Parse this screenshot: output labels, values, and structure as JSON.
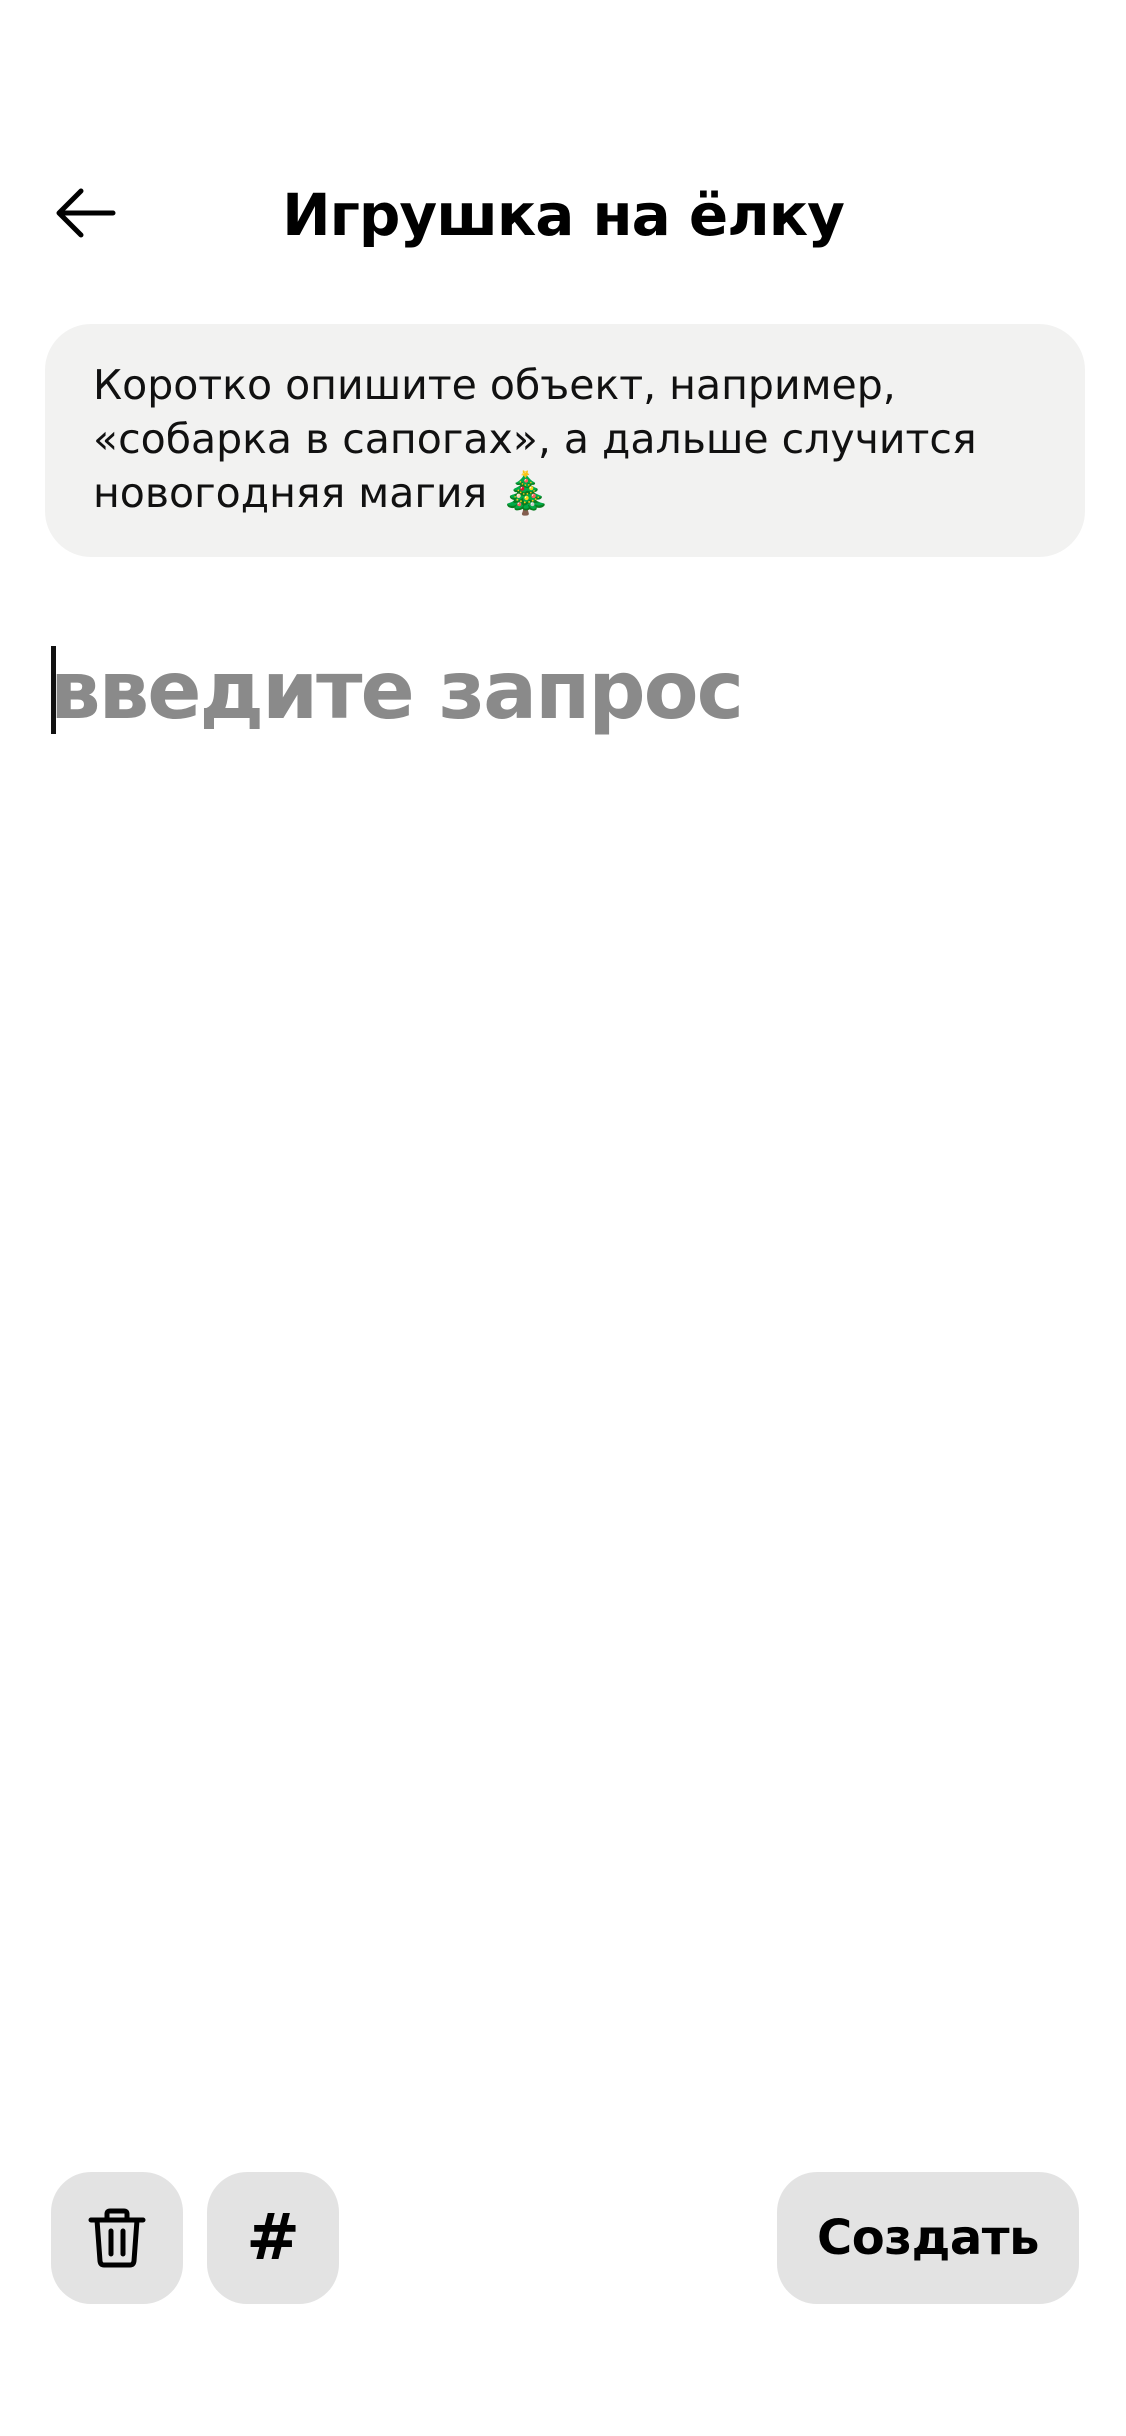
{
  "header": {
    "title": "Игрушка на ёлку",
    "back_icon": "arrow-left-icon"
  },
  "hint": {
    "text": "Коротко опишите объект, например,\n«собарка в сапогах», а дальше случится\nновогодняя магия 🎄"
  },
  "query": {
    "value": "",
    "placeholder": "введите запрос"
  },
  "toolbar": {
    "delete_icon": "trash-icon",
    "hashtag_icon": "hashtag-icon",
    "hashtag_symbol": "#",
    "create_label": "Создать"
  },
  "colors": {
    "background": "#ffffff",
    "hint_background": "#f2f2f1",
    "button_background": "#e3e3e3",
    "placeholder": "#8a8a8a",
    "text": "#000000"
  }
}
